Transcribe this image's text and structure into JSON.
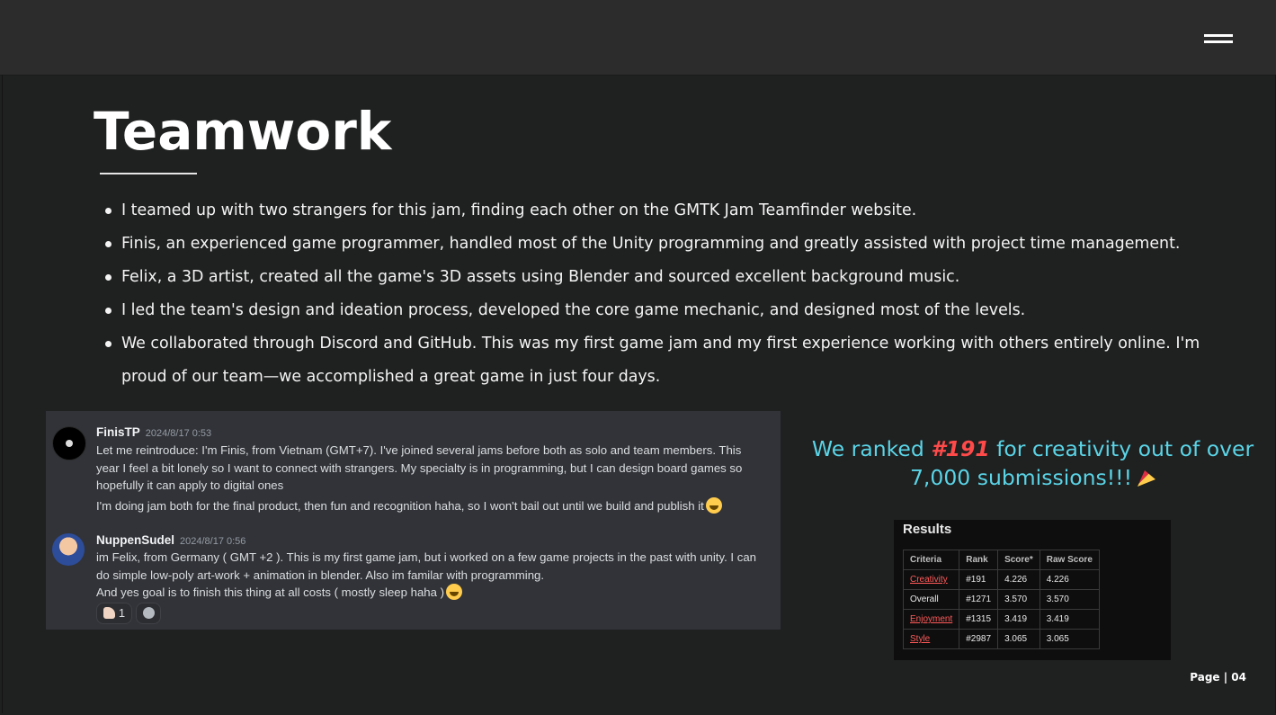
{
  "slide": {
    "title": "Teamwork",
    "bullets": [
      "I teamed up with two strangers for this jam, finding each other on the GMTK Jam Teamfinder website.",
      "Finis, an experienced game programmer, handled most of the Unity programming and greatly assisted with project time management.",
      "Felix, a 3D artist, created all the game's 3D assets using Blender and sourced excellent background music.",
      "I led the team's design and ideation process, developed the core game mechanic, and designed most of the levels.",
      "We collaborated through Discord and GitHub. This was my first game jam and my first experience working with others entirely online. I'm proud of our team—we accomplished a great game in just four days."
    ],
    "page_label": "Page | 04"
  },
  "discord": {
    "messages": [
      {
        "username": "FinisTP",
        "timestamp": "2024/8/17 0:53",
        "lines": [
          "Let me reintroduce: I'm Finis, from Vietnam (GMT+7). I've joined several jams before both as solo and team members. This year I feel a bit lonely so I want to connect with strangers. My specialty is in programming, but I can design board games so hopefully it can apply to digital ones",
          "I'm doing jam both for the final product, then fun and recognition haha, so I won't bail out until we build and publish it"
        ]
      },
      {
        "username": "NuppenSudel",
        "timestamp": "2024/8/17 0:56",
        "lines": [
          "im Felix, from Germany ( GMT +2 ). This is my first game jam, but i worked on a few game projects in the past with unity. I can do simple low-poly art-work + animation in blender. Also im familar with programming.",
          "And yes goal is to finish this thing at all costs ( mostly sleep haha )"
        ]
      }
    ],
    "reactions": [
      {
        "icon": "flexed-biceps-icon",
        "count": "1"
      },
      {
        "icon": "add-reaction-icon",
        "count": ""
      }
    ]
  },
  "ranked": {
    "prefix": "We ranked ",
    "rank": "#191",
    "suffix": " for creativity out of over 7,000 submissions!!!"
  },
  "results": {
    "title": "Results",
    "headers": [
      "Criteria",
      "Rank",
      "Score*",
      "Raw Score"
    ],
    "rows": [
      [
        "Creativity",
        "#191",
        "4.226",
        "4.226"
      ],
      [
        "Overall",
        "#1271",
        "3.570",
        "3.570"
      ],
      [
        "Enjoyment",
        "#1315",
        "3.419",
        "3.419"
      ],
      [
        "Style",
        "#2987",
        "3.065",
        "3.065"
      ]
    ]
  },
  "colors": {
    "accent_cyan": "#5ad4e6",
    "accent_red": "#ff4a4a",
    "discord_bg": "#313338"
  }
}
